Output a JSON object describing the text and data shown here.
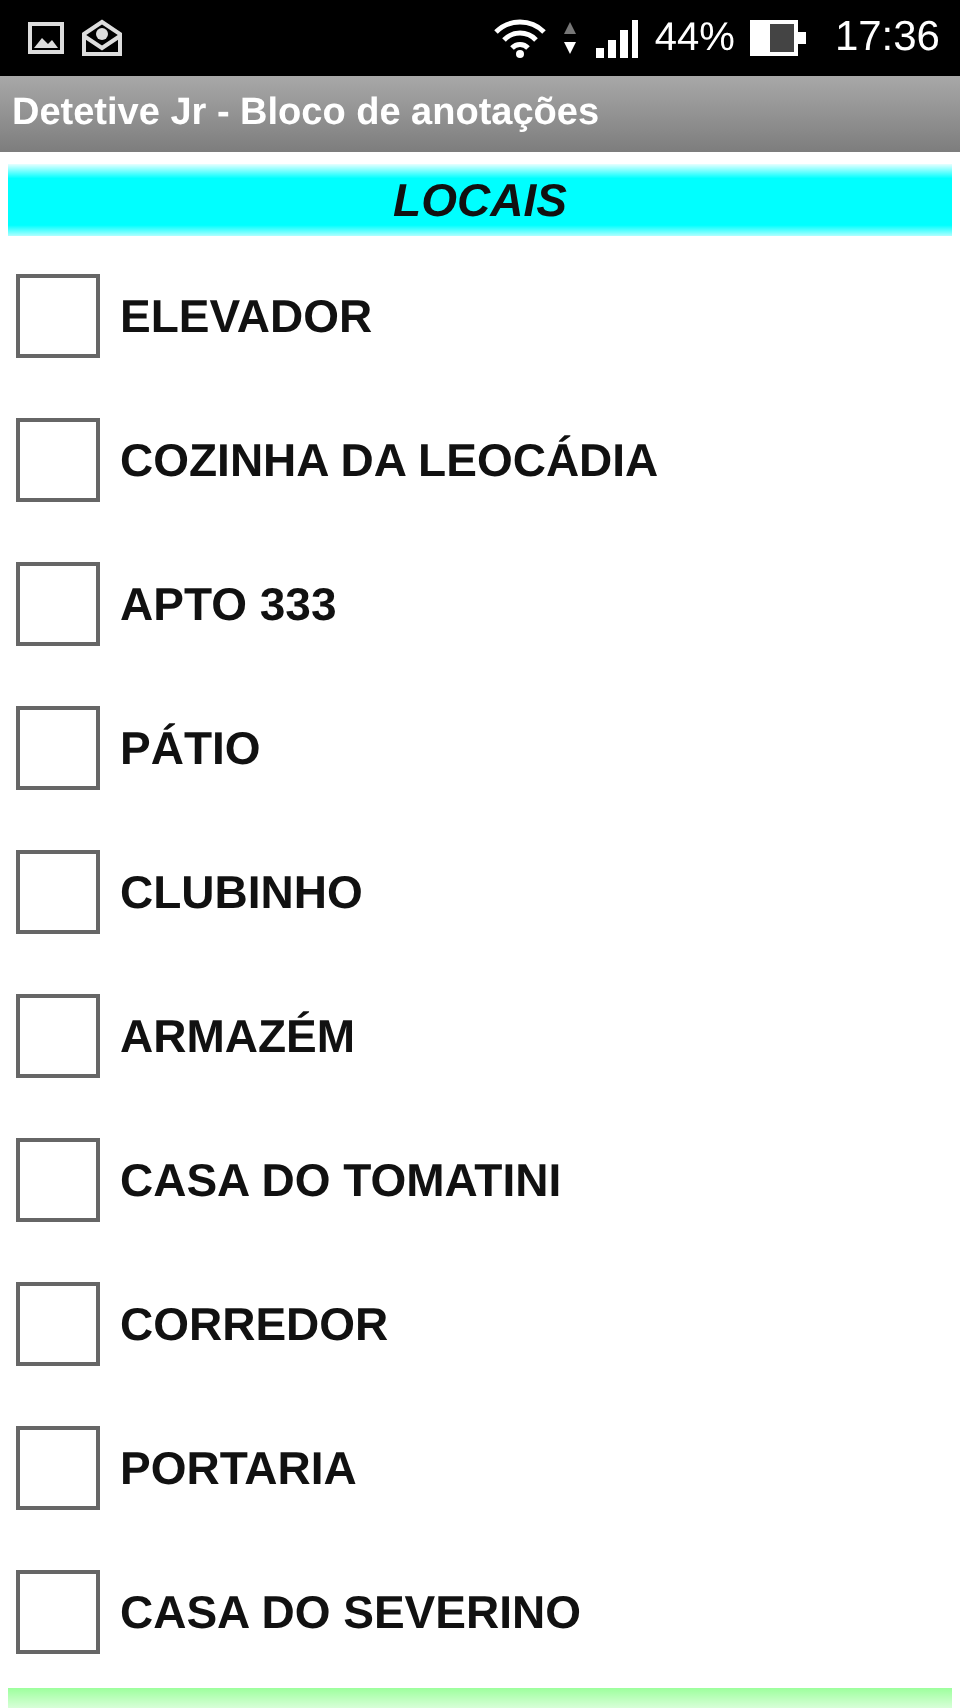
{
  "status_bar": {
    "battery_text": "44%",
    "time": "17:36"
  },
  "window": {
    "title": "Detetive Jr - Bloco de anotações"
  },
  "section": {
    "title": "LOCAIS"
  },
  "items": [
    {
      "label": "ELEVADOR",
      "checked": false
    },
    {
      "label": "COZINHA DA LEOCÁDIA",
      "checked": false
    },
    {
      "label": "APTO 333",
      "checked": false
    },
    {
      "label": "PÁTIO",
      "checked": false
    },
    {
      "label": "CLUBINHO",
      "checked": false
    },
    {
      "label": "ARMAZÉM",
      "checked": false
    },
    {
      "label": "CASA DO TOMATINI",
      "checked": false
    },
    {
      "label": "CORREDOR",
      "checked": false
    },
    {
      "label": "PORTARIA",
      "checked": false
    },
    {
      "label": "CASA DO SEVERINO",
      "checked": false
    }
  ]
}
